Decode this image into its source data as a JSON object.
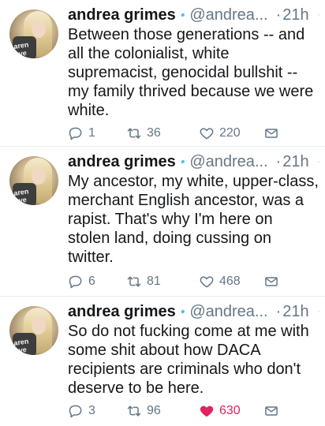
{
  "colors": {
    "verified": "#1da1f2",
    "meta": "#657786",
    "like_active": "#e0245e",
    "text": "#14171a"
  },
  "tweets": [
    {
      "name": "andrea grimes",
      "handle": "@andrea...",
      "time": "21h",
      "dot": "·",
      "text": "Between those generations -- and all the colonialist, white supremacist, genocidal bullshit -- my family thrived because we were white.",
      "avatar_text": "aren\nave",
      "replies": "1",
      "retweets": "36",
      "likes": "220",
      "liked": false,
      "icons": {
        "reply": "reply-icon",
        "retweet": "retweet-icon",
        "like": "heart-icon",
        "message": "envelope-icon"
      }
    },
    {
      "name": "andrea grimes",
      "handle": "@andrea...",
      "time": "21h",
      "dot": "·",
      "text": "My ancestor, my white, upper-class, merchant English ancestor, was a rapist. That's why I'm here on stolen land, doing cussing on twitter.",
      "avatar_text": "aren\nave",
      "replies": "6",
      "retweets": "81",
      "likes": "468",
      "liked": false,
      "icons": {
        "reply": "reply-icon",
        "retweet": "retweet-icon",
        "like": "heart-icon",
        "message": "envelope-icon"
      }
    },
    {
      "name": "andrea grimes",
      "handle": "@andrea...",
      "time": "21h",
      "dot": "·",
      "text": "So do not fucking come at me with some shit about how DACA recipients are criminals who don't deserve to be here.",
      "avatar_text": "aren\nave",
      "replies": "3",
      "retweets": "96",
      "likes": "630",
      "liked": true,
      "icons": {
        "reply": "reply-icon",
        "retweet": "retweet-icon",
        "like": "heart-filled-icon",
        "message": "envelope-icon"
      }
    }
  ]
}
